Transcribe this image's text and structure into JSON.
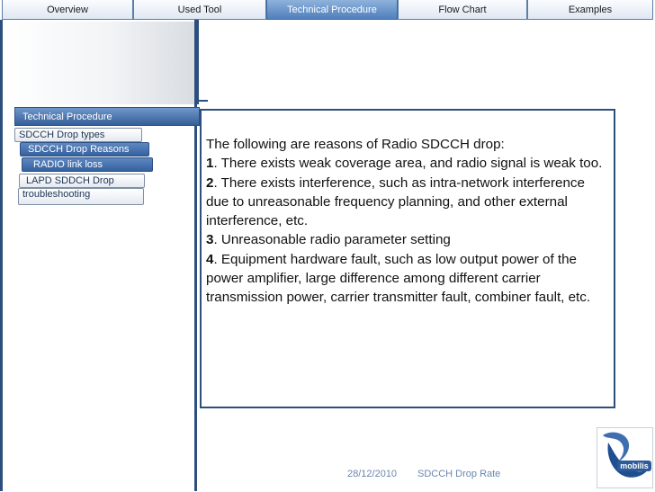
{
  "tabs": [
    "Overview",
    "Used Tool",
    "Technical Procedure",
    "Flow Chart",
    "Examples"
  ],
  "active_tab": "Technical Procedure",
  "nav": {
    "header": "Technical Procedure",
    "items": [
      "SDCCH Drop types",
      "SDCCH Drop Reasons",
      "RADIO link loss",
      "LAPD SDDCH Drop",
      "troubleshooting"
    ]
  },
  "content": {
    "intro": "The following are reasons of Radio SDCCH drop:",
    "reasons": [
      {
        "num": "1",
        "text": ".   There exists weak coverage area, and radio signal is weak too."
      },
      {
        "num": "2",
        "text": ".  There exists interference, such as intra-network interference due to unreasonable frequency planning, and other external interference, etc."
      },
      {
        "num": "3",
        "text": ".  Unreasonable radio parameter setting"
      },
      {
        "num": "4",
        "text": ".  Equipment hardware fault, such as low output power of the power amplifier, large difference among different carrier transmission power, carrier transmitter fault, combiner fault, etc."
      }
    ]
  },
  "footer": {
    "date": "28/12/2010",
    "title": "SDCCH Drop Rate"
  },
  "logo": {
    "text": "mobilis"
  },
  "colors": {
    "accent": "#2d4f7e",
    "tab_active": "#4f7fbb",
    "footer_text": "#6c86ad"
  }
}
